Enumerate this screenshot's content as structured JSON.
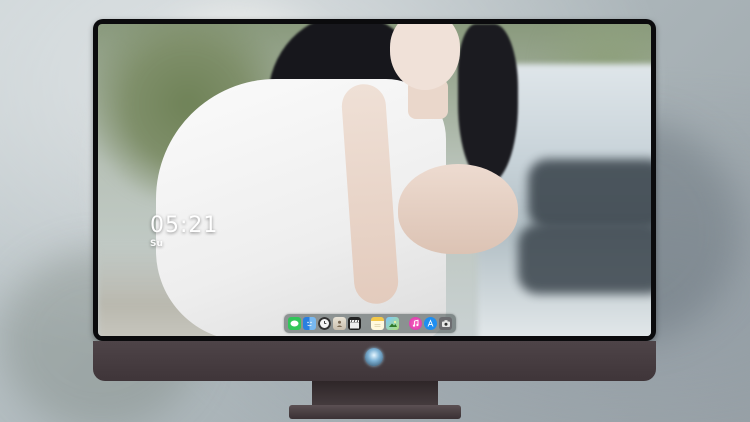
{
  "lock_screen": {
    "time": "05:21",
    "date": "Su"
  },
  "dock": {
    "items": [
      {
        "icon": "messages-icon"
      },
      {
        "icon": "finder-icon"
      },
      {
        "icon": "clock-icon"
      },
      {
        "icon": "contacts-icon"
      },
      {
        "icon": "clapperboard-icon"
      },
      {
        "icon": "notes-icon"
      },
      {
        "icon": "photos-icon"
      },
      {
        "icon": "itunes-icon"
      },
      {
        "icon": "app-store-icon"
      },
      {
        "icon": "camera-icon"
      }
    ]
  },
  "colors": {
    "monitor_chin": "#4e4448",
    "bezel": "#0b0b0d",
    "dock_background": "#465050"
  }
}
